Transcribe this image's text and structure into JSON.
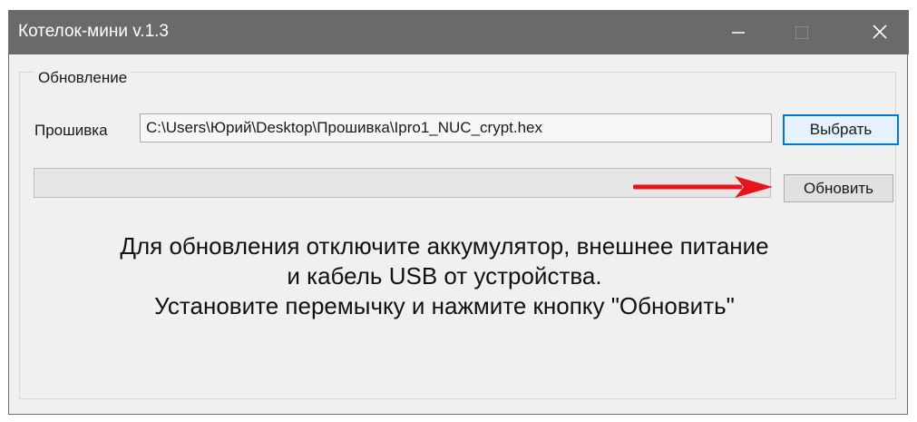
{
  "window": {
    "title": "Котелок-мини v.1.3",
    "controls": [
      "minimize-icon",
      "maximize-icon",
      "close-icon"
    ]
  },
  "update_group": {
    "title": "Обновление",
    "firmware_label": "Прошивка",
    "firmware_path": "C:\\Users\\Юрий\\Desktop\\Прошивка\\Ipro1_NUC_crypt.hex",
    "select_button": "Выбрать",
    "update_button": "Обновить",
    "progress": 0,
    "instructions": [
      "Для обновления отключите аккумулятор, внешнее питание",
      "и кабель USB от устройства.",
      "Установите перемычку и нажмите кнопку \"Обновить\""
    ]
  },
  "annotation": {
    "icon": "arrow-right-icon",
    "color": "#e8141c"
  },
  "colors": {
    "titlebar": "#6a6a6a",
    "focus_border": "#0078d7",
    "window_bg": "#f0f0f0"
  }
}
